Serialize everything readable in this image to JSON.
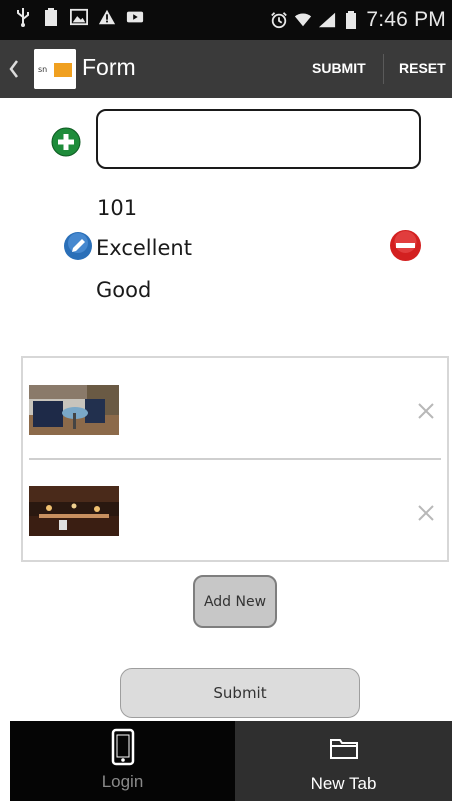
{
  "status_bar": {
    "time": "7:46 PM",
    "icons": [
      "usb-icon",
      "battery-full-icon",
      "image-icon",
      "warning-icon",
      "video-icon",
      "alarm-icon",
      "wifi-icon",
      "signal-icon",
      "battery-icon"
    ]
  },
  "action_bar": {
    "title": "Form",
    "submit_label": "SUBMIT",
    "reset_label": "RESET",
    "logo_text": "snappii"
  },
  "form": {
    "input_value": "",
    "items": [
      "101",
      "Excellent",
      "Good"
    ]
  },
  "photos": [
    {
      "name": "patio-photo"
    },
    {
      "name": "restaurant-photo"
    }
  ],
  "buttons": {
    "add_new": "Add New",
    "submit": "Submit"
  },
  "tabs": [
    {
      "label": "Login",
      "icon": "phone-icon",
      "active": false
    },
    {
      "label": "New Tab",
      "icon": "folder-icon",
      "active": true
    }
  ],
  "colors": {
    "status_bar": "#0b0b0b",
    "action_bar": "#3a3a3a",
    "add_green": "#1e8c3a",
    "remove_red": "#d32020",
    "edit_blue": "#2a6fb8"
  }
}
